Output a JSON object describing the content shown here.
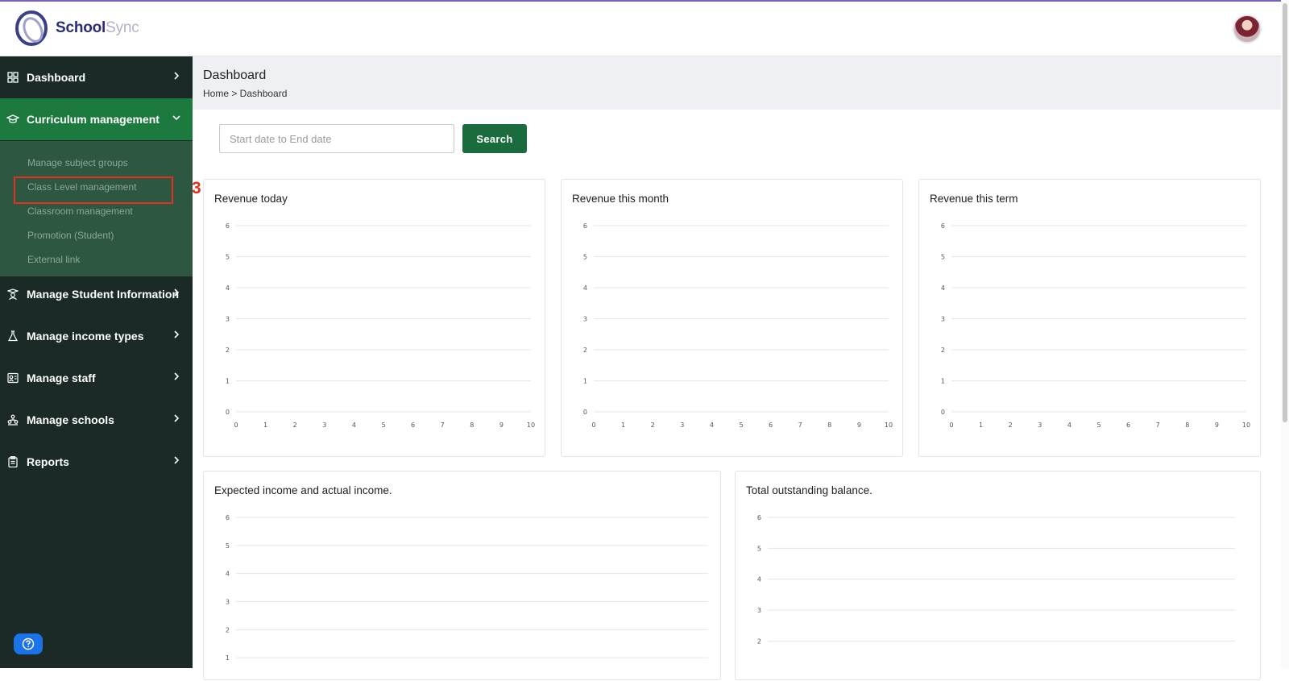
{
  "app": {
    "brand_primary": "School",
    "brand_secondary": "Sync"
  },
  "sidebar": {
    "items": [
      {
        "label": "Dashboard",
        "icon": "grid-icon"
      },
      {
        "label": "Curriculum management",
        "icon": "graduation-cap-icon",
        "expanded": true
      },
      {
        "label": "Manage Student Information",
        "icon": "student-icon"
      },
      {
        "label": "Manage income types",
        "icon": "flask-icon"
      },
      {
        "label": "Manage staff",
        "icon": "staff-icon"
      },
      {
        "label": "Manage schools",
        "icon": "schools-icon"
      },
      {
        "label": "Reports",
        "icon": "clipboard-icon"
      }
    ],
    "submenu": [
      "Manage subject groups",
      "Class Level management",
      "Classroom management",
      "Promotion (Student)",
      "External link"
    ],
    "annotation_marker": "3"
  },
  "page": {
    "title": "Dashboard",
    "breadcrumb": "Home > Dashboard"
  },
  "filter": {
    "date_placeholder": "Start date to End date",
    "search_label": "Search"
  },
  "colors": {
    "sidebar_bg": "#1b2a26",
    "active_bg": "#1c7a3e",
    "submenu_bg": "#2e5741",
    "button_green": "#1a6b3d",
    "highlight_red": "#e0301e"
  },
  "chart_data": [
    {
      "type": "line",
      "title": "Revenue today",
      "xlim": [
        0,
        10
      ],
      "ylim": [
        0,
        6
      ],
      "x_ticks": [
        0,
        1,
        2,
        3,
        4,
        5,
        6,
        7,
        8,
        9,
        10
      ],
      "y_ticks": [
        0,
        1,
        2,
        3,
        4,
        5,
        6
      ],
      "series": [],
      "grid": true
    },
    {
      "type": "line",
      "title": "Revenue this month",
      "xlim": [
        0,
        10
      ],
      "ylim": [
        0,
        6
      ],
      "x_ticks": [
        0,
        1,
        2,
        3,
        4,
        5,
        6,
        7,
        8,
        9,
        10
      ],
      "y_ticks": [
        0,
        1,
        2,
        3,
        4,
        5,
        6
      ],
      "series": [],
      "grid": true
    },
    {
      "type": "line",
      "title": "Revenue this term",
      "xlim": [
        0,
        10
      ],
      "ylim": [
        0,
        6
      ],
      "x_ticks": [
        0,
        1,
        2,
        3,
        4,
        5,
        6,
        7,
        8,
        9,
        10
      ],
      "y_ticks": [
        0,
        1,
        2,
        3,
        4,
        5,
        6
      ],
      "series": [],
      "grid": true
    },
    {
      "type": "line",
      "title": "Expected income and actual income.",
      "ylim": [
        0,
        6
      ],
      "y_ticks": [
        1,
        2,
        3,
        4,
        5,
        6
      ],
      "series": [],
      "grid": true
    },
    {
      "type": "line",
      "title": "Total outstanding balance.",
      "ylim": [
        0,
        6
      ],
      "y_ticks": [
        2,
        3,
        4,
        5,
        6
      ],
      "series": [],
      "grid": true
    }
  ]
}
